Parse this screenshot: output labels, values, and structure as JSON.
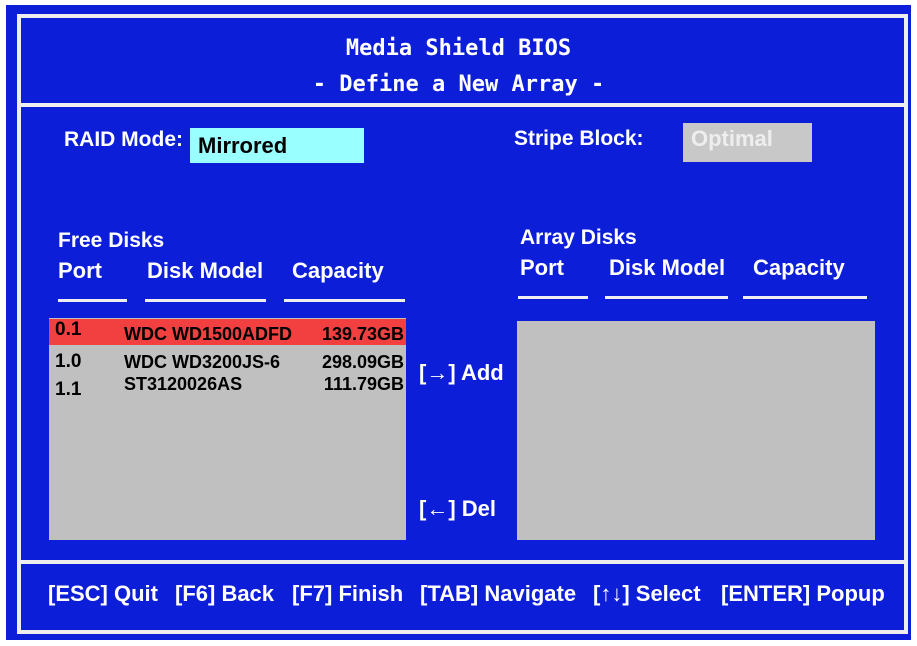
{
  "header": {
    "title": "Media Shield BIOS",
    "subtitle": "- Define a New Array -"
  },
  "raid_mode": {
    "label": "RAID Mode:",
    "value": "Mirrored"
  },
  "stripe_block": {
    "label": "Stripe Block:",
    "value": "Optimal"
  },
  "free_disks": {
    "title": "Free Disks",
    "columns": [
      "Port",
      "Disk Model",
      "Capacity"
    ],
    "rows": [
      {
        "port": "0.1",
        "model": "WDC WD1500ADFD",
        "capacity": "139.73GB"
      },
      {
        "port": "1.0",
        "model": "WDC WD3200JS-6",
        "capacity": "298.09GB"
      },
      {
        "port": "1.1",
        "model": "ST3120026AS",
        "capacity": "111.79GB"
      }
    ]
  },
  "actions": {
    "add": "[→] Add",
    "del": "[←] Del"
  },
  "array_disks": {
    "title": "Array Disks",
    "columns": [
      "Port",
      "Disk Model",
      "Capacity"
    ]
  },
  "help": {
    "esc": "[ESC] Quit",
    "f6": "[F6] Back",
    "f7": "[F7] Finish",
    "tab": "[TAB] Navigate",
    "select": "[↑↓] Select",
    "enter": "[ENTER] Popup"
  },
  "colors": {
    "background": "#0d1ed8",
    "border": "#eeeeee",
    "raid_field": "#99ffff",
    "stripe_field": "#c8c8c8",
    "panel": "#c0c0c0",
    "selected_row": "#f24040"
  }
}
